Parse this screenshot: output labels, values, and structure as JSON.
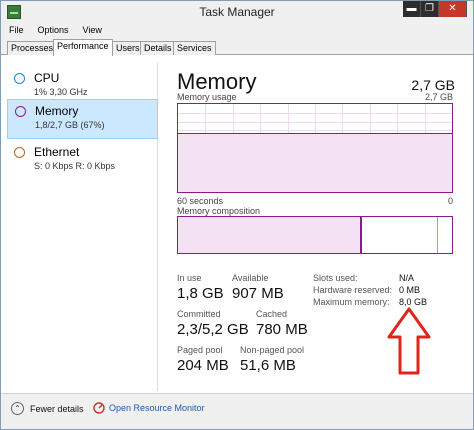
{
  "window": {
    "title": "Task Manager"
  },
  "controls": {
    "minimize": "▬",
    "restore": "❐",
    "close": "✕"
  },
  "menu": [
    "File",
    "Options",
    "View"
  ],
  "tabs": [
    {
      "label": "Processes",
      "active": false
    },
    {
      "label": "Performance",
      "active": true
    },
    {
      "label": "Users",
      "active": false
    },
    {
      "label": "Details",
      "active": false
    },
    {
      "label": "Services",
      "active": false
    }
  ],
  "sidebar": [
    {
      "name": "CPU",
      "detail": "1%  3,30 GHz",
      "color": "#1a86d9",
      "selected": false
    },
    {
      "name": "Memory",
      "detail": "1,8/2,7 GB (67%)",
      "color": "#8b1a8b",
      "selected": true
    },
    {
      "name": "Ethernet",
      "detail": "S: 0 Kbps  R: 0 Kbps",
      "color": "#b5651d",
      "selected": false
    }
  ],
  "main": {
    "title": "Memory",
    "total": "2,7 GB",
    "usage_label": "Memory usage",
    "usage_max": "2,7 GB",
    "usage_fraction": 0.67,
    "time_left": "60 seconds",
    "time_right": "0",
    "composition_label": "Memory composition",
    "composition": {
      "in_use_fraction": 0.67,
      "modified_fraction": 0.0,
      "standby_fraction": 0.28,
      "free_fraction": 0.05
    }
  },
  "stats": {
    "in_use_label": "In use",
    "in_use": "1,8 GB",
    "available_label": "Available",
    "available": "907 MB",
    "committed_label": "Committed",
    "committed": "2,3/5,2 GB",
    "cached_label": "Cached",
    "cached": "780 MB",
    "paged_label": "Paged pool",
    "paged": "204 MB",
    "nonpaged_label": "Non-paged pool",
    "nonpaged": "51,6 MB"
  },
  "details": {
    "slots_label": "Slots used:",
    "slots": "N/A",
    "hw_label": "Hardware reserved:",
    "hw": "0 MB",
    "max_label": "Maximum memory:",
    "max": "8,0 GB"
  },
  "footer": {
    "fewer_details": "Fewer details",
    "resource_monitor": "Open Resource Monitor"
  },
  "colors": {
    "memory": "#8b1a8b",
    "annotation_arrow": "#e0241b"
  }
}
